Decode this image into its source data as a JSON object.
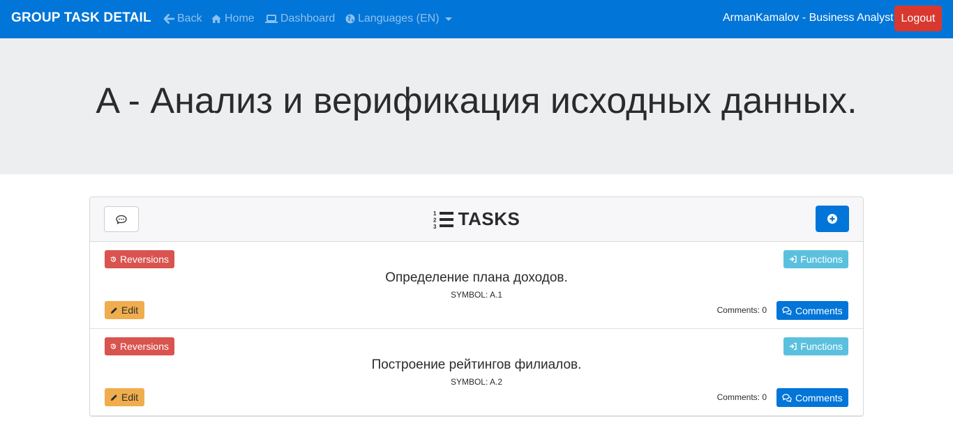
{
  "navbar": {
    "brand": "GROUP TASK DETAIL",
    "links": [
      {
        "label": "Back",
        "icon": "arrow-left-icon"
      },
      {
        "label": "Home",
        "icon": "home-icon"
      },
      {
        "label": "Dashboard",
        "icon": "laptop-icon"
      },
      {
        "label": "Languages (EN)",
        "icon": "globe-icon"
      }
    ],
    "user": "ArmanKamalov - Business Analyst",
    "logout": "Logout",
    "colors": {
      "background": "#0275d8",
      "logout": "#d9382f"
    }
  },
  "page": {
    "title": "A - Анализ и верификация исходных данных."
  },
  "tasks_panel": {
    "heading": "TASKS",
    "heading_icon": "list-ol-icon",
    "chat_icon": "comment-icon",
    "add_icon": "plus-circle-icon",
    "tasks": [
      {
        "name": "Определение плана доходов.",
        "symbol": "SYMBOL: A.1",
        "reversions": "Reversions",
        "functions": "Functions",
        "edit": "Edit",
        "comments_count": "Comments: 0",
        "comments": "Comments"
      },
      {
        "name": "Построение рейтингов филиалов.",
        "symbol": "SYMBOL: A.2",
        "reversions": "Reversions",
        "functions": "Functions",
        "edit": "Edit",
        "comments_count": "Comments: 0",
        "comments": "Comments"
      }
    ]
  }
}
